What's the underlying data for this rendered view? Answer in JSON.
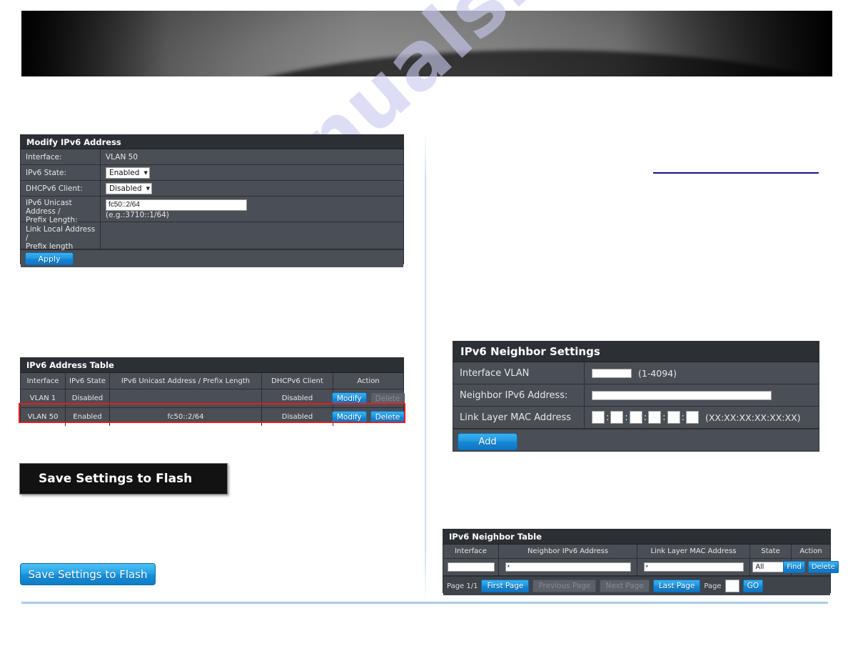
{
  "watermark": {
    "text": "manualshive.com"
  },
  "modify_ipv6_address": {
    "title": "Modify IPv6 Address",
    "rows": {
      "interface_label": "Interface:",
      "interface_value": "VLAN 50",
      "ipv6_state_label": "IPv6 State:",
      "ipv6_state_value": "Enabled",
      "dhcpv6_client_label": "DHCPv6 Client:",
      "dhcpv6_client_value": "Disabled",
      "unicast_label_line1": "IPv6 Unicast Address /",
      "unicast_label_line2": "Prefix Length:",
      "unicast_value": "fc50::2/64",
      "unicast_hint": "(e.g.:3710::1/64)",
      "link_local_label_line1": "Link Local Address /",
      "link_local_label_line2": "Prefix length",
      "link_local_value": ""
    },
    "apply_label": "Apply"
  },
  "ipv6_address_table": {
    "title": "IPv6 Address Table",
    "columns": [
      "Interface",
      "IPv6 State",
      "IPv6 Unicast Address / Prefix Length",
      "DHCPv6 Client",
      "Action"
    ],
    "rows": [
      {
        "interface": "VLAN 1",
        "state": "Disabled",
        "address": "",
        "dhcpv6": "Disabled",
        "modify_label": "Modify",
        "delete_label": "Delete",
        "delete_disabled": true,
        "highlighted": false
      },
      {
        "interface": "VLAN 50",
        "state": "Enabled",
        "address": "fc50::2/64",
        "dhcpv6": "Disabled",
        "modify_label": "Modify",
        "delete_label": "Delete",
        "delete_disabled": false,
        "highlighted": true
      }
    ]
  },
  "save_bar": {
    "label": "Save Settings to Flash"
  },
  "save_button": {
    "label": "Save Settings to Flash"
  },
  "ipv6_neighbor_settings": {
    "title": "IPv6 Neighbor Settings",
    "interface_vlan_label": "Interface VLAN",
    "interface_vlan_value": "",
    "interface_vlan_range": "(1-4094)",
    "neighbor_address_label": "Neighbor IPv6 Address:",
    "neighbor_address_value": "",
    "mac_label": "Link Layer MAC Address",
    "mac_format": "(XX:XX:XX:XX:XX:XX)",
    "mac_separator": ":",
    "mac_octets": [
      "",
      "",
      "",
      "",
      "",
      ""
    ],
    "add_label": "Add"
  },
  "ipv6_neighbor_table": {
    "title": "IPv6 Neighbor Table",
    "columns": [
      "Interface",
      "Neighbor IPv6 Address",
      "Link Layer MAC Address",
      "State",
      "Action"
    ],
    "filter": {
      "interface": "",
      "neighbor_address": "*",
      "mac_address": "*",
      "state": "All",
      "find_label": "Find",
      "delete_label": "Delete"
    },
    "pagination": {
      "page_status": "Page 1/1",
      "first_page": "First Page",
      "previous_page": "Previous Page",
      "next_page": "Next Page",
      "last_page": "Last Page",
      "page_label": "Page",
      "page_value": "",
      "go_label": "GO"
    }
  },
  "colors": {
    "accent_blue": "#1f95e0",
    "panel_bg": "#4a4e55",
    "panel_header": "#2c2f34",
    "highlight_red": "#e81c1c",
    "rule_blue": "#15158c",
    "footer_rule": "#a9cce6"
  }
}
